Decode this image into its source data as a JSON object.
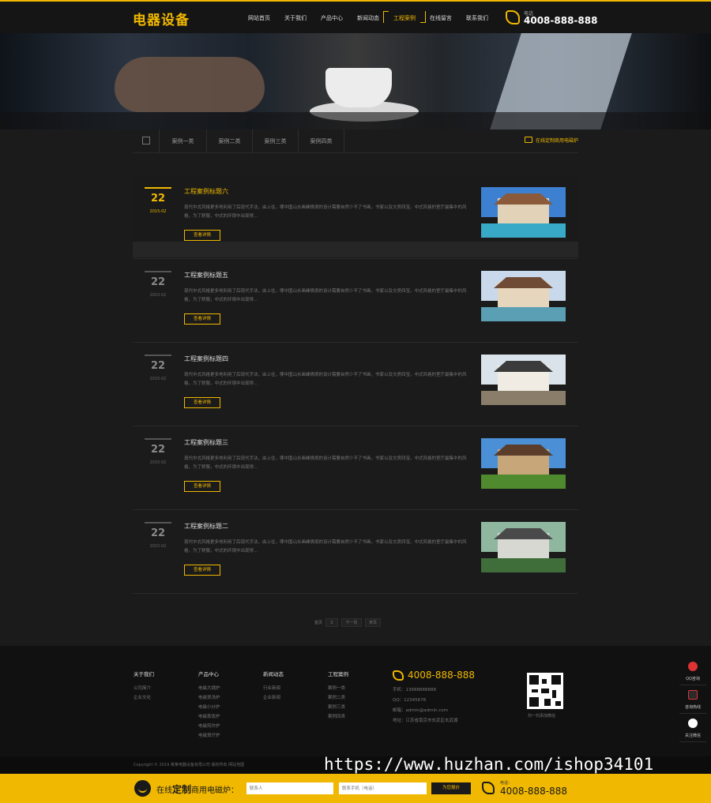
{
  "header": {
    "logo": "电器设备",
    "nav": [
      "网站首页",
      "关于我们",
      "产品中心",
      "新闻动态",
      "工程案例",
      "在线留言",
      "联系我们"
    ],
    "active_nav": "工程案例",
    "phone_label": "电话",
    "phone": "4008-888-888"
  },
  "subnav": {
    "tabs": [
      "案例一类",
      "案例二类",
      "案例三类",
      "案例四类"
    ],
    "online_order": "在线定制商用电磁炉"
  },
  "cases": [
    {
      "day": "22",
      "ym": "2015-02",
      "title": "工程案例标题六",
      "desc": "现代中式风格更多地利用了后现代手法，由上往，哪中国山水画峰情境的设计需要自然少不了书画，书家以及文房四宝。中式风格的室厅最集中的风格，为了舒服，中式的环境中出现得...",
      "more": "查看详情"
    },
    {
      "day": "22",
      "ym": "2015-02",
      "title": "工程案例标题五",
      "desc": "现代中式风格更多地利用了后现代手法，由上往，哪中国山水画峰情境的设计需要自然少不了书画，书家以及文房四宝。中式风格的室厅最集中的风格，为了舒服，中式的环境中出现得...",
      "more": "查看详情"
    },
    {
      "day": "22",
      "ym": "2015-02",
      "title": "工程案例标题四",
      "desc": "现代中式风格更多地利用了后现代手法，由上往，哪中国山水画峰情境的设计需要自然少不了书画，书家以及文房四宝。中式风格的室厅最集中的风格，为了舒服，中式的环境中出现得...",
      "more": "查看详情"
    },
    {
      "day": "22",
      "ym": "2015-02",
      "title": "工程案例标题三",
      "desc": "现代中式风格更多地利用了后现代手法，由上往，哪中国山水画峰情境的设计需要自然少不了书画，书家以及文房四宝。中式风格的室厅最集中的风格，为了舒服，中式的环境中出现得...",
      "more": "查看详情"
    },
    {
      "day": "22",
      "ym": "2015-02",
      "title": "工程案例标题二",
      "desc": "现代中式风格更多地利用了后现代手法，由上往，哪中国山水画峰情境的设计需要自然少不了书画，书家以及文房四宝。中式风格的室厅最集中的风格，为了舒服，中式的环境中出现得...",
      "more": "查看详情"
    }
  ],
  "pager": {
    "label": "首页",
    "current": "2",
    "next": "下一页",
    "last": "末页"
  },
  "footer": {
    "col1": {
      "title": "关于我们",
      "links": [
        "公司简介",
        "企业文化"
      ]
    },
    "col2": {
      "title": "产品中心",
      "links": [
        "电磁大锅炉",
        "电磁煲汤炉",
        "电磁小炒炉",
        "电磁蒸饭炉",
        "电磁煎炸炉",
        "电磁煲仔炉"
      ]
    },
    "col3": {
      "title": "新闻动态",
      "links": [
        "行业新闻",
        "企业新闻"
      ]
    },
    "col4": {
      "title": "工程案例",
      "links": [
        "案例一类",
        "案例二类",
        "案例三类",
        "案例四类"
      ]
    },
    "phone": "4008-888-888",
    "mobile": "手机：13688888888",
    "qq": "QQ：12345678",
    "email": "邮箱：admin@admin.com",
    "address": "地址：江苏省南京市玄武区玄武湖",
    "qr_caption": "扫一扫添加微信"
  },
  "copyright": "Copyright © 2019 某某电器设备有限公司 版权所有   网站地图",
  "watermark": "https://www.huzhan.com/ishop34101",
  "bottom_bar": {
    "label_prefix": "在线",
    "label_bold": "定制",
    "label_suffix": "商用电磁炉：",
    "name_placeholder": "联系人",
    "phone_placeholder": "联系手机（电话）",
    "submit": "为您报价",
    "phone_label": "电话：",
    "phone": "4008-888-888"
  },
  "side_float": [
    "QQ咨询",
    "咨询热线",
    "关注微信"
  ],
  "colors": {
    "accent": "#f0b800",
    "background": "#1b1b1b"
  }
}
